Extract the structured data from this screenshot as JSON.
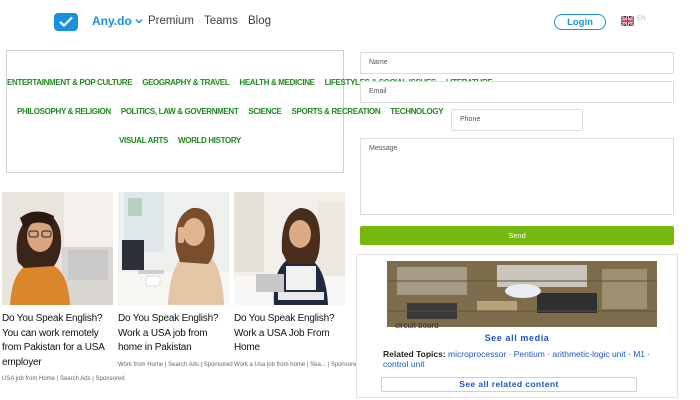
{
  "nav": {
    "brand": "Any.do",
    "links": [
      "Premium",
      "Teams",
      "Blog"
    ],
    "login": "Login",
    "language": "EN"
  },
  "categories": {
    "line1": [
      "ENTERTAINMENT & POP CULTURE",
      "GEOGRAPHY & TRAVEL",
      "HEALTH & MEDICINE",
      "LIFESTYLES & SOCIAL ISSUES",
      "LITERATURE"
    ],
    "line2": [
      "PHILOSOPHY & RELIGION",
      "POLITICS, LAW & GOVERNMENT",
      "SCIENCE",
      "SPORTS & RECREATION",
      "TECHNOLOGY"
    ],
    "line3": [
      "VISUAL ARTS",
      "WORLD HISTORY"
    ],
    "separator": "·"
  },
  "articles": [
    {
      "title": "Do You Speak English? You can work remotely from Pakistan for a USA employer",
      "source": "USA job from Home",
      "tag": "Search Ads",
      "sponsored": "Sponsored"
    },
    {
      "title": "Do You Speak English? Work a USA job from home in Pakistan",
      "source": "Work from Home",
      "tag": "Search Ads",
      "sponsored": "Sponsored"
    },
    {
      "title": "Do You Speak English? Work a USA Job From Home",
      "source": "Work a Usa job from home",
      "tag": "Sea...",
      "sponsored": "Sponsored"
    }
  ],
  "form": {
    "name_placeholder": "Name",
    "email_placeholder": "Email",
    "phone_placeholder": "Phone",
    "message_placeholder": "Message",
    "send_label": "Send"
  },
  "media": {
    "caption": "circuit board",
    "see_all_media": "See all media",
    "related_label": "Related Topics:",
    "related_topics": "microprocessor · Pentium · arithmetic-logic unit · M1 · control unit",
    "see_all_related": "See all related content"
  },
  "colors": {
    "brand_blue": "#1a8fe0",
    "category_green": "#1f8a1f",
    "send_green": "#74b810",
    "link_blue": "#1a55c8"
  },
  "icons": {
    "logo": "check-badge-icon",
    "dropdown": "chevron-down-icon",
    "flag": "uk-flag-icon"
  }
}
